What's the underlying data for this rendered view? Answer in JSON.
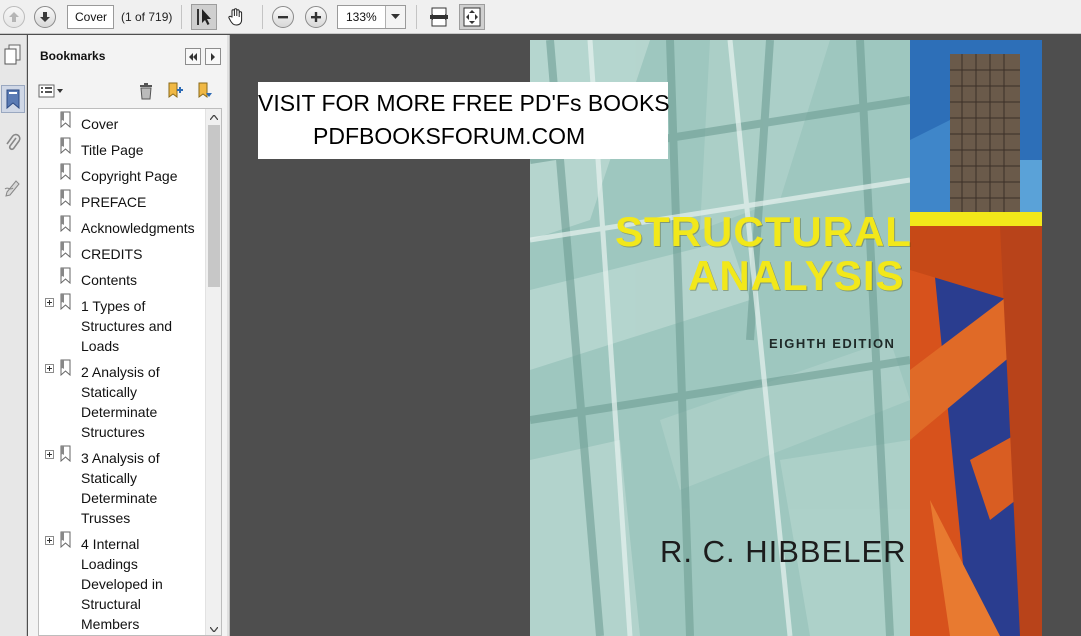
{
  "toolbar": {
    "page_value": "Cover",
    "page_count": "(1 of 719)",
    "zoom": "133%",
    "icons": [
      "previous-page-icon",
      "next-page-icon",
      "select-tool-icon",
      "hand-tool-icon",
      "zoom-out-icon",
      "zoom-in-icon",
      "dropdown-arrow-icon",
      "fit-width-icon",
      "fit-page-icon"
    ]
  },
  "side_strip": {
    "icons": [
      "pages-icon",
      "bookmarks-icon",
      "attachments-icon",
      "signatures-icon"
    ]
  },
  "bookmarks_panel": {
    "title": "Bookmarks",
    "items": [
      {
        "label": "Cover",
        "expandable": false
      },
      {
        "label": "Title Page",
        "expandable": false
      },
      {
        "label": "Copyright Page",
        "expandable": false
      },
      {
        "label": "PREFACE",
        "expandable": false
      },
      {
        "label": "Acknowledgments",
        "expandable": false
      },
      {
        "label": "CREDITS",
        "expandable": false
      },
      {
        "label": "Contents",
        "expandable": false
      },
      {
        "label": "1 Types of Structures and Loads",
        "expandable": true
      },
      {
        "label": "2 Analysis of Statically Determinate Structures",
        "expandable": true
      },
      {
        "label": "3 Analysis of Statically Determinate Trusses",
        "expandable": true
      },
      {
        "label": "4 Internal Loadings Developed in Structural Members",
        "expandable": true
      }
    ]
  },
  "document": {
    "banner_line1": "VISIT FOR MORE FREE PD'Fs BOOKS",
    "banner_line2": "PDFBOOKSFORUM.COM",
    "cover_title_line1": "STRUCTURAL",
    "cover_title_line2": "ANALYSIS",
    "edition": "EIGHTH EDITION",
    "author": "R. C. HIBBELER"
  },
  "colors": {
    "cover_title": "#f2e81a",
    "cover_background": "#9cc4bc",
    "viewer_background": "#4e4e4e",
    "steel_beam": "#d7521c"
  }
}
